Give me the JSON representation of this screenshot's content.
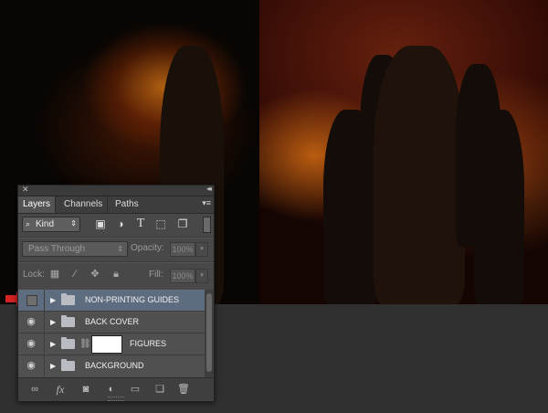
{
  "panel": {
    "close_glyph": "✕",
    "collapse_glyph": "◂◂",
    "tabs": [
      {
        "label": "Layers",
        "active": true
      },
      {
        "label": "Channels",
        "active": false
      },
      {
        "label": "Paths",
        "active": false
      }
    ],
    "menu_glyph": "▾≡",
    "filter": {
      "kind_label": "Kind",
      "icons": [
        "image-filter-icon",
        "adjustment-filter-icon",
        "type-filter-icon",
        "shape-filter-icon",
        "smart-object-filter-icon"
      ]
    },
    "blend_mode": "Pass Through",
    "opacity_label": "Opacity:",
    "opacity_value": "100%",
    "lock_label": "Lock:",
    "fill_label": "Fill:",
    "fill_value": "100%",
    "layers": [
      {
        "name": "NON-PRINTING GUIDES",
        "visible": false,
        "selected": true,
        "type": "group"
      },
      {
        "name": "BACK COVER",
        "visible": true,
        "selected": false,
        "type": "group"
      },
      {
        "name": "FIGURES",
        "visible": true,
        "selected": false,
        "type": "group",
        "has_mask": true
      },
      {
        "name": "BACKGROUND",
        "visible": true,
        "selected": false,
        "type": "group"
      }
    ],
    "footer_icons": [
      "link-layers-icon",
      "fx-icon",
      "add-mask-icon",
      "adjustment-layer-icon",
      "new-group-icon",
      "new-layer-icon",
      "trash-icon"
    ],
    "fx_label": "fx"
  },
  "colors": {
    "indicator_arrow": "#d42323",
    "selected_row": "#5e6c80"
  }
}
